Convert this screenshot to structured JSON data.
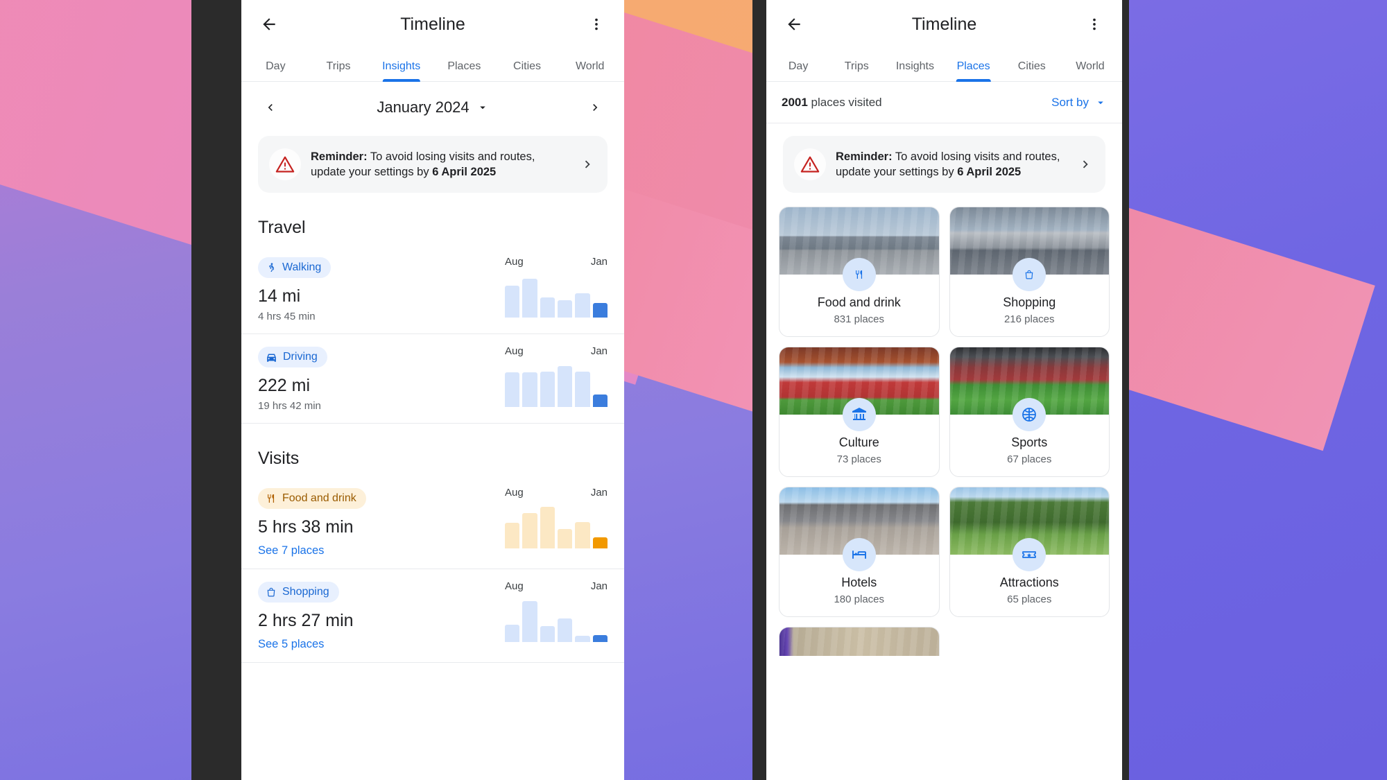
{
  "app": {
    "title": "Timeline",
    "back_icon": "back-arrow-icon",
    "overflow_icon": "more-vert-icon"
  },
  "tabs": [
    "Day",
    "Trips",
    "Insights",
    "Places",
    "Cities",
    "World"
  ],
  "left_phone": {
    "active_tab": "Insights",
    "month_selector": {
      "prev_icon": "chevron-left-icon",
      "next_icon": "chevron-right-icon",
      "label": "January 2024",
      "dropdown_icon": "arrow-drop-down-icon"
    },
    "reminder": {
      "icon": "warning-triangle-icon",
      "bold_prefix": "Reminder:",
      "text": " To avoid losing visits and routes, update your settings by ",
      "bold_date": "6 April 2025",
      "chevron_icon": "chevron-right-icon"
    },
    "sections": [
      {
        "title": "Travel",
        "rows": [
          {
            "chip_label": "Walking",
            "chip_icon": "walking-icon",
            "chip_style": "blue",
            "value": "14 mi",
            "sub": "4 hrs 45 min",
            "link": null,
            "axis_start": "Aug",
            "axis_end": "Jan"
          },
          {
            "chip_label": "Driving",
            "chip_icon": "car-icon",
            "chip_style": "blue",
            "value": "222 mi",
            "sub": "19 hrs 42 min",
            "link": null,
            "axis_start": "Aug",
            "axis_end": "Jan"
          }
        ]
      },
      {
        "title": "Visits",
        "rows": [
          {
            "chip_label": "Food and drink",
            "chip_icon": "restaurant-icon",
            "chip_style": "orange",
            "value": "5 hrs 38 min",
            "sub": null,
            "link": "See 7 places",
            "axis_start": "Aug",
            "axis_end": "Jan"
          },
          {
            "chip_label": "Shopping",
            "chip_icon": "shopping-bag-icon",
            "chip_style": "blue",
            "value": "2 hrs 27 min",
            "sub": null,
            "link": "See 5 places",
            "axis_start": "Aug",
            "axis_end": "Jan"
          }
        ]
      }
    ]
  },
  "right_phone": {
    "active_tab": "Places",
    "summary": {
      "count": "2001",
      "count_suffix": " places visited",
      "sort_label": "Sort by",
      "sort_icon": "arrow-drop-down-icon"
    },
    "reminder": {
      "icon": "warning-triangle-icon",
      "bold_prefix": "Reminder:",
      "text": " To avoid losing visits and routes, update your settings by ",
      "bold_date": "6 April 2025",
      "chevron_icon": "chevron-right-icon"
    },
    "place_cards": [
      {
        "name": "Food and drink",
        "count": "831 places",
        "icon": "restaurant-icon",
        "photo": "ph-food"
      },
      {
        "name": "Shopping",
        "count": "216 places",
        "icon": "shopping-bag-icon",
        "photo": "ph-shop"
      },
      {
        "name": "Culture",
        "count": "73 places",
        "icon": "museum-icon",
        "photo": "ph-cult"
      },
      {
        "name": "Sports",
        "count": "67 places",
        "icon": "basketball-icon",
        "photo": "ph-spor"
      },
      {
        "name": "Hotels",
        "count": "180 places",
        "icon": "bed-icon",
        "photo": "ph-hote"
      },
      {
        "name": "Attractions",
        "count": "65 places",
        "icon": "ticket-star-icon",
        "photo": "ph-attr"
      }
    ]
  },
  "colors": {
    "accent_blue": "#1a73e8",
    "bar_blue_light": "#d6e4fb",
    "bar_blue_active": "#3b7ddd",
    "bar_orange_light": "#fce8c4",
    "bar_orange_active": "#f29900",
    "chip_blue_bg": "#e8f0fe",
    "chip_orange_bg": "#fdf0d9",
    "warning_red": "#c5221f",
    "text_primary": "#202124",
    "text_secondary": "#5f6368",
    "card_bg": "#f5f6f7"
  },
  "chart_data": [
    {
      "type": "bar",
      "title": "Walking",
      "categories": [
        "Aug",
        "Sep",
        "Oct",
        "Nov",
        "Dec",
        "Jan"
      ],
      "values": [
        41,
        50,
        26,
        22,
        31,
        19
      ],
      "ylim": [
        0,
        55
      ],
      "xlabel": "",
      "ylabel": "",
      "grid": false,
      "legend": "none",
      "highlight_index": 5,
      "color_base": "#d6e4fb",
      "color_highlight": "#3b7ddd",
      "tick_labels_shown": [
        "Aug",
        "Jan"
      ]
    },
    {
      "type": "bar",
      "title": "Driving",
      "categories": [
        "Aug",
        "Sep",
        "Oct",
        "Nov",
        "Dec",
        "Jan"
      ],
      "values": [
        44,
        44,
        45,
        52,
        45,
        16
      ],
      "ylim": [
        0,
        55
      ],
      "xlabel": "",
      "ylabel": "",
      "grid": false,
      "legend": "none",
      "highlight_index": 5,
      "color_base": "#d6e4fb",
      "color_highlight": "#3b7ddd",
      "tick_labels_shown": [
        "Aug",
        "Jan"
      ]
    },
    {
      "type": "bar",
      "title": "Food and drink",
      "categories": [
        "Aug",
        "Sep",
        "Oct",
        "Nov",
        "Dec",
        "Jan"
      ],
      "values": [
        33,
        45,
        53,
        25,
        34,
        14
      ],
      "ylim": [
        0,
        55
      ],
      "xlabel": "",
      "ylabel": "",
      "grid": false,
      "legend": "none",
      "highlight_index": 5,
      "color_base": "#fce8c4",
      "color_highlight": "#f29900",
      "tick_labels_shown": [
        "Aug",
        "Jan"
      ]
    },
    {
      "type": "bar",
      "title": "Shopping",
      "categories": [
        "Aug",
        "Sep",
        "Oct",
        "Nov",
        "Dec",
        "Jan"
      ],
      "values": [
        22,
        52,
        20,
        30,
        8,
        9
      ],
      "ylim": [
        0,
        55
      ],
      "xlabel": "",
      "ylabel": "",
      "grid": false,
      "legend": "none",
      "highlight_index": 5,
      "color_base": "#d6e4fb",
      "color_highlight": "#3b7ddd",
      "tick_labels_shown": [
        "Aug",
        "Jan"
      ]
    }
  ]
}
